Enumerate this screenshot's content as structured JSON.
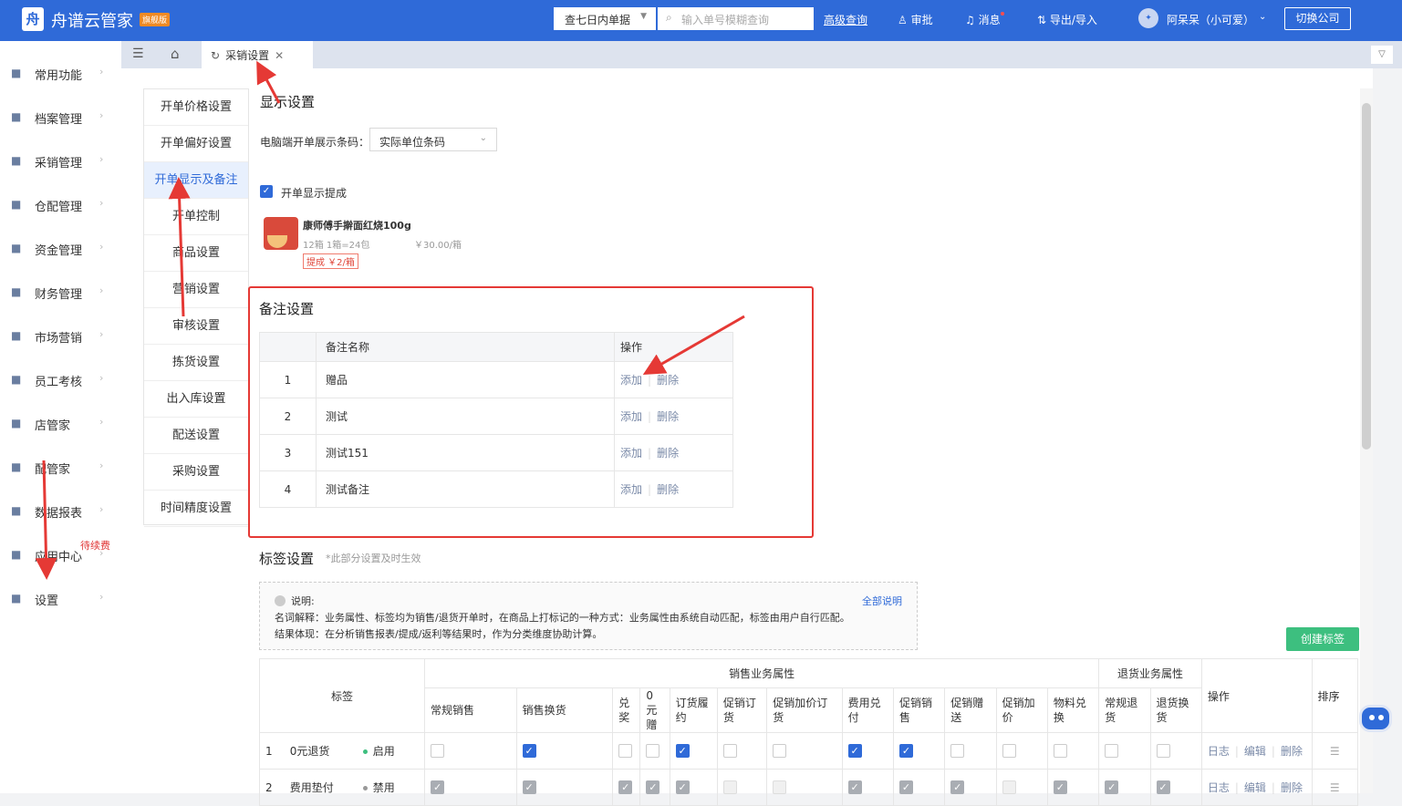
{
  "app": {
    "title": "舟谱云管家",
    "edition": "旗舰版",
    "logo_char": "舟"
  },
  "topbar": {
    "range": "查七日内单据",
    "search_placeholder": "输入单号模糊查询",
    "advanced": "高级查询",
    "approve": "审批",
    "messages": "消息",
    "export_import": "导出/导入",
    "user": "阿呆呆（小可爱）",
    "switch_company": "切换公司"
  },
  "sidebar": {
    "items": [
      {
        "label": "常用功能",
        "icon": "grid-icon"
      },
      {
        "label": "档案管理",
        "icon": "archive-icon"
      },
      {
        "label": "采销管理",
        "icon": "document-icon"
      },
      {
        "label": "仓配管理",
        "icon": "warehouse-icon"
      },
      {
        "label": "资金管理",
        "icon": "money-icon"
      },
      {
        "label": "财务管理",
        "icon": "calculator-icon"
      },
      {
        "label": "市场营销",
        "icon": "store-icon"
      },
      {
        "label": "员工考核",
        "icon": "people-icon"
      },
      {
        "label": "店管家",
        "icon": "shop-icon"
      },
      {
        "label": "配管家",
        "icon": "location-icon"
      },
      {
        "label": "数据报表",
        "icon": "chart-icon"
      },
      {
        "label": "应用中心",
        "icon": "apps-icon"
      },
      {
        "label": "设置",
        "icon": "gear-icon"
      }
    ],
    "renew_badge": "待续费"
  },
  "tab": {
    "label": "采销设置"
  },
  "subnav": [
    "开单价格设置",
    "开单偏好设置",
    "开单显示及备注",
    "开单控制",
    "商品设置",
    "营销设置",
    "审核设置",
    "拣货设置",
    "出入库设置",
    "配送设置",
    "采购设置",
    "时间精度设置"
  ],
  "display": {
    "title": "显示设置",
    "barcode_label": "电脑端开单展示条码：",
    "barcode_value": "实际单位条码",
    "show_commission": "开单显示提成",
    "product_name": "康师傅手擀面红烧100g",
    "product_qty": "12箱  1箱=24包",
    "product_price": "￥30.00/箱",
    "commission_tag": "提成 ￥2/箱"
  },
  "remarks": {
    "title": "备注设置",
    "headers": [
      "",
      "备注名称",
      "操作"
    ],
    "add": "添加",
    "delete": "删除",
    "rows": [
      {
        "n": "1",
        "name": "赠品"
      },
      {
        "n": "2",
        "name": "测试"
      },
      {
        "n": "3",
        "name": "测试151"
      },
      {
        "n": "4",
        "name": "测试备注"
      }
    ]
  },
  "tags": {
    "title": "标签设置",
    "note": "*此部分设置及时生效",
    "info_label": "说明:",
    "info_all": "全部说明",
    "info_line1": "名词解释：业务属性、标签均为销售/退货开单时，在商品上打标记的一种方式：业务属性由系统自动匹配，标签由用户自行匹配。",
    "info_line2": "结果体现：在分析销售报表/提成/返利等结果时，作为分类维度协助计算。",
    "create": "创建标签",
    "h_tag": "标签",
    "h_sales": "销售业务属性",
    "h_return": "退货业务属性",
    "h_ops": "操作",
    "h_sort": "排序",
    "cols": [
      "常规销售",
      "销售换货",
      "兑奖",
      "0元赠",
      "订货履约",
      "促销订货",
      "促销加价订货",
      "费用兑付",
      "促销销售",
      "促销赠送",
      "促销加价",
      "物料兑换",
      "常规退货",
      "退货换货"
    ],
    "log": "日志",
    "edit": "编辑",
    "del": "删除",
    "rows": [
      {
        "n": "1",
        "name": "0元退货",
        "status": "启用",
        "status_color": "#3dbf7f",
        "checks": [
          "",
          "on",
          "",
          "",
          "on",
          "",
          "",
          "on",
          "on",
          "",
          "",
          "",
          "",
          ""
        ]
      },
      {
        "n": "2",
        "name": "费用垫付",
        "status": "禁用",
        "status_color": "#999999",
        "checks": [
          "g",
          "g",
          "g",
          "g",
          "g",
          "d",
          "d",
          "g",
          "g",
          "g",
          "d",
          "g",
          "g",
          "g"
        ]
      }
    ]
  }
}
